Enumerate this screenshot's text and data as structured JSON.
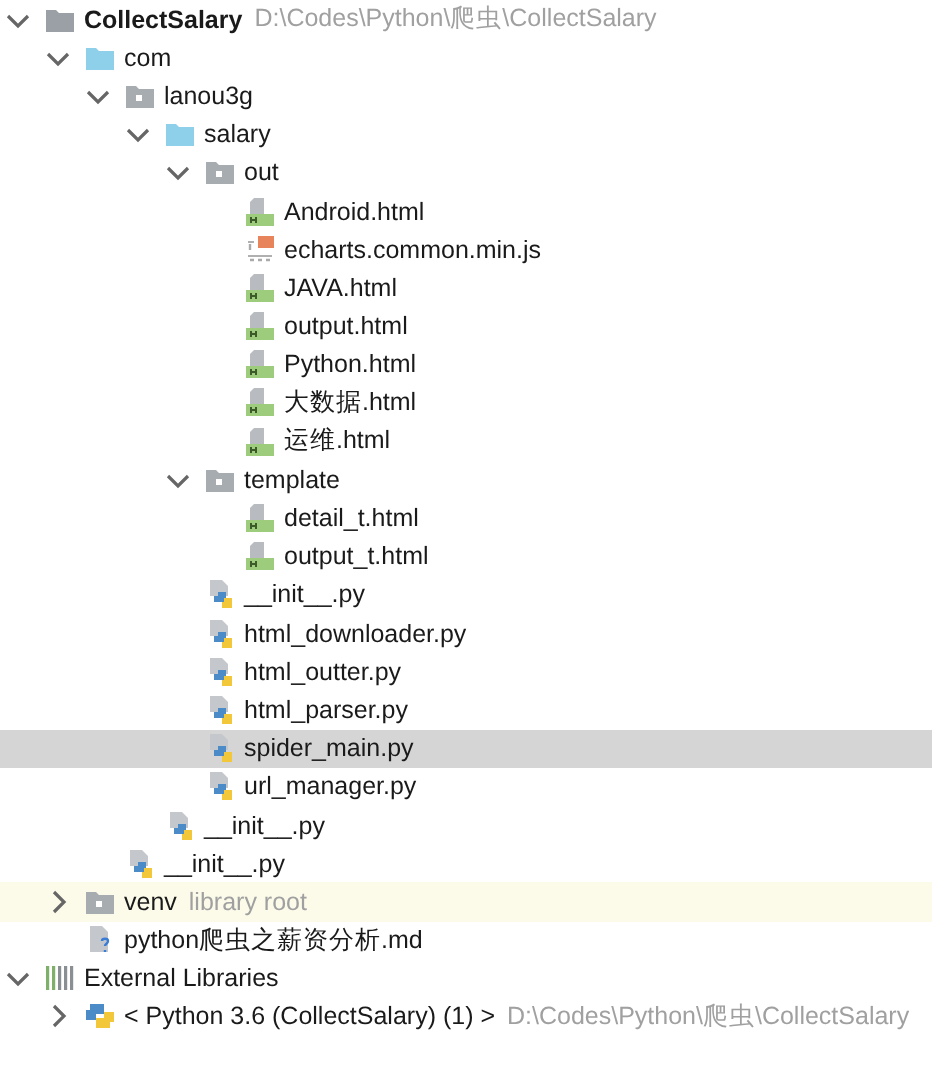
{
  "tree": [
    {
      "kind": "project",
      "label": "CollectSalary",
      "detail": "D:\\Codes\\Python\\爬虫\\CollectSalary",
      "expanded": true,
      "selected": false,
      "children": [
        {
          "kind": "package",
          "label": "com",
          "expanded": true,
          "selected": false,
          "children": [
            {
              "kind": "folder",
              "label": "lanou3g",
              "expanded": true,
              "selected": false,
              "children": [
                {
                  "kind": "package",
                  "label": "salary",
                  "expanded": true,
                  "selected": false,
                  "children": [
                    {
                      "kind": "folder",
                      "label": "out",
                      "expanded": true,
                      "selected": false,
                      "children": [
                        {
                          "kind": "html",
                          "label": "Android.html",
                          "selected": false
                        },
                        {
                          "kind": "js",
                          "label": "echarts.common.min.js",
                          "selected": false
                        },
                        {
                          "kind": "html",
                          "label": "JAVA.html",
                          "selected": false
                        },
                        {
                          "kind": "html",
                          "label": "output.html",
                          "selected": false
                        },
                        {
                          "kind": "html",
                          "label": "Python.html",
                          "selected": false
                        },
                        {
                          "kind": "html",
                          "label": "大数据.html",
                          "selected": false
                        },
                        {
                          "kind": "html",
                          "label": "运维.html",
                          "selected": false
                        }
                      ]
                    },
                    {
                      "kind": "folder",
                      "label": "template",
                      "expanded": true,
                      "selected": false,
                      "children": [
                        {
                          "kind": "html",
                          "label": "detail_t.html",
                          "selected": false
                        },
                        {
                          "kind": "html",
                          "label": "output_t.html",
                          "selected": false
                        }
                      ]
                    },
                    {
                      "kind": "python",
                      "label": "__init__.py",
                      "selected": false
                    },
                    {
                      "kind": "python",
                      "label": "html_downloader.py",
                      "selected": false
                    },
                    {
                      "kind": "python",
                      "label": "html_outter.py",
                      "selected": false
                    },
                    {
                      "kind": "python",
                      "label": "html_parser.py",
                      "selected": false
                    },
                    {
                      "kind": "python",
                      "label": "spider_main.py",
                      "selected": true
                    },
                    {
                      "kind": "python",
                      "label": "url_manager.py",
                      "selected": false
                    }
                  ]
                },
                {
                  "kind": "python",
                  "label": "__init__.py",
                  "selected": false
                }
              ]
            },
            {
              "kind": "python",
              "label": "__init__.py",
              "selected": false
            }
          ]
        },
        {
          "kind": "folder",
          "label": "venv",
          "detail": "library root",
          "expanded": false,
          "highlighted": true,
          "selected": false
        },
        {
          "kind": "markdown",
          "label": "python爬虫之薪资分析.md",
          "selected": false
        }
      ]
    },
    {
      "kind": "libraries",
      "label": "External Libraries",
      "expanded": true,
      "selected": false,
      "children": [
        {
          "kind": "sdk",
          "label": "< Python 3.6 (CollectSalary) (1) >",
          "detail": "D:\\Codes\\Python\\爬虫\\CollectSalary",
          "expanded": false,
          "selected": false
        }
      ]
    }
  ]
}
